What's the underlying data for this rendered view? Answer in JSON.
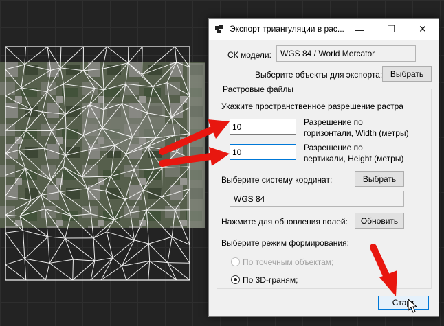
{
  "window": {
    "title": "Экспорт триангуляции в рас..."
  },
  "window_controls": {
    "minimize": "—",
    "maximize": "☐",
    "close": "✕"
  },
  "cs_model": {
    "label": "СК модели:",
    "value": "WGS 84 / World Mercator"
  },
  "select_objects": {
    "label": "Выберите объекты для экспорта:",
    "button": "Выбрать"
  },
  "raster": {
    "group_title": "Растровые файлы",
    "resolution_hint": "Укажите  пространственное  разрешение  растра",
    "width": {
      "value": "10",
      "label_line1": "Разрешение  по",
      "label_line2": "горизонтали, Width (метры)"
    },
    "height": {
      "value": "10",
      "label_line1": "Разрешение  по",
      "label_line2": "вертикали, Height (метры)"
    },
    "coord_system": {
      "label": "Выберите систему кординат:",
      "button": "Выбрать",
      "value": "WGS 84"
    },
    "refresh": {
      "label": "Нажмите для обновления полей:",
      "button": "Обновить"
    },
    "mode": {
      "label": "Выберите режим формирования:",
      "options": [
        {
          "label": "По точечным объектам;",
          "selected": false,
          "enabled": false
        },
        {
          "label": "По 3D-граням;",
          "selected": true,
          "enabled": true
        }
      ]
    }
  },
  "start_button": "Старт",
  "colors": {
    "accent": "#0078d7",
    "annotation_arrow": "#e8170f",
    "mesh": "#ffffff"
  }
}
